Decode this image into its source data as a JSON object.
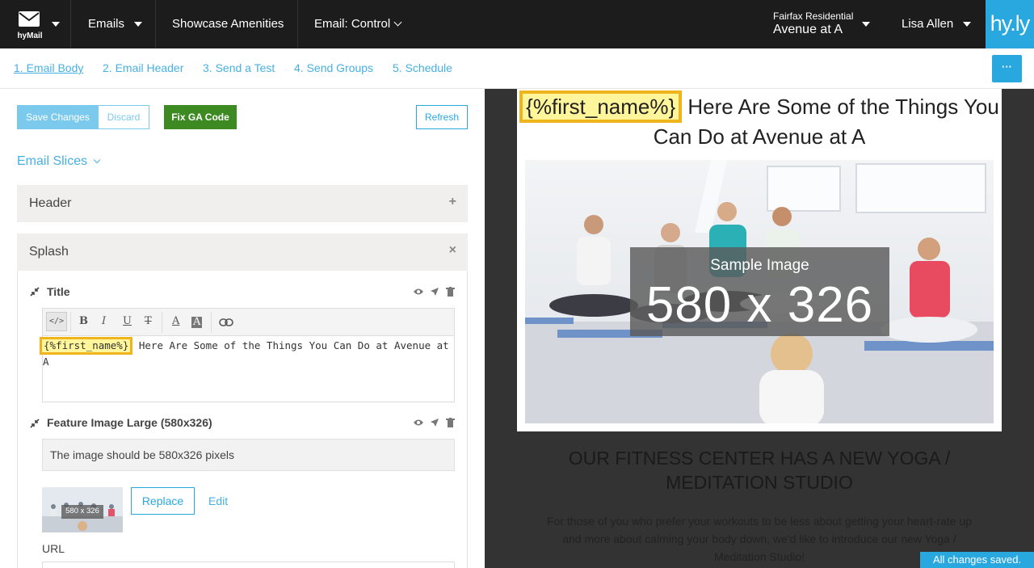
{
  "nav": {
    "logo_label": "hyMail",
    "emails": "Emails",
    "showcase": "Showcase Amenities",
    "email_control": "Email: Control",
    "property_company": "Fairfax Residential",
    "property_name": "Avenue at A",
    "user": "Lisa Allen",
    "brand": "hy.ly"
  },
  "steps": [
    "1. Email Body",
    "2. Email Header",
    "3. Send a Test",
    "4. Send Groups",
    "5. Schedule"
  ],
  "more_label": "···",
  "toolbar": {
    "save": "Save Changes",
    "discard": "Discard",
    "fix_ga": "Fix GA Code",
    "refresh": "Refresh"
  },
  "slices": {
    "title": "Email Slices",
    "header_label": "Header",
    "header_action": "+",
    "splash_label": "Splash",
    "splash_action": "×"
  },
  "title_field": {
    "label": "Title",
    "token": "{%first_name%}",
    "text": " Here Are Some of the Things You Can Do at Avenue at A"
  },
  "editor_buttons": {
    "code": "</>",
    "bold": "B",
    "italic": "I",
    "underline": "U",
    "strike": "T",
    "font_color": "A",
    "bg_color": "A"
  },
  "feature_image": {
    "label": "Feature Image Large (580x326)",
    "description": "The image should be 580x326 pixels",
    "thumb_label": "580 x 326",
    "replace": "Replace",
    "edit": "Edit",
    "url_label": "URL"
  },
  "preview": {
    "token": "{%first_name%}",
    "headline_rest": " Here Are Some of the Things You Can Do at Avenue at A",
    "sample_label": "Sample Image",
    "sample_size": "580 x 326",
    "section_heading": "OUR FITNESS CENTER HAS A NEW YOGA / MEDITATION STUDIO",
    "section_body": "For those of you who prefer your workouts to be less about getting your heart-rate up and more about calming your body down, we'd like to introduce our new Yoga / Meditation Studio!"
  },
  "status": "All changes saved.",
  "colors": {
    "accent": "#29a8e0",
    "nav_bg": "#1c1c1c",
    "green": "#3d8a22",
    "highlight": "#fff59a",
    "highlight_border": "#f0b41d"
  }
}
